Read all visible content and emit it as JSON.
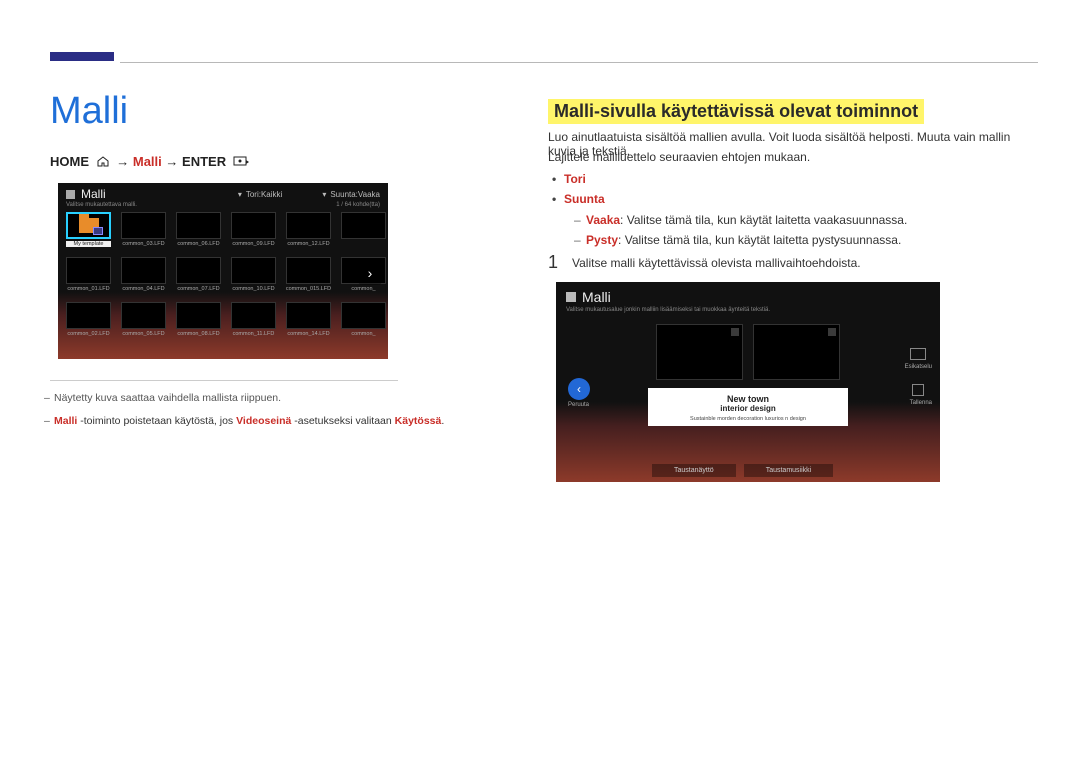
{
  "page": {
    "h1": "Malli",
    "breadcrumb": {
      "home": "HOME",
      "arrow": "→",
      "malli": "Malli",
      "enter": "ENTER"
    },
    "note1": "Näytetty kuva saattaa vaihdella mallista riippuen.",
    "note2_pre": "Malli",
    "note2_mid1": " -toiminto poistetaan käytöstä, jos ",
    "note2_accent2": "Videoseinä",
    "note2_mid2": " -asetukseksi valitaan ",
    "note2_accent3": "Käytössä",
    "note2_end": "."
  },
  "right": {
    "h2": "Malli-sivulla käytettävissä olevat toiminnot",
    "para1": "Luo ainutlaatuista sisältöä mallien avulla. Voit luoda sisältöä helposti. Muuta vain mallin kuvia ja tekstiä.",
    "para2": "Lajittele malliluettelo seuraavien ehtojen mukaan.",
    "b1": "Tori",
    "b2": "Suunta",
    "sb1_accent": "Vaaka",
    "sb1_text": ": Valitse tämä tila, kun käytät laitetta vaakasuunnassa.",
    "sb2_accent": "Pysty",
    "sb2_text": ": Valitse tämä tila, kun käytät laitetta pystysuunnassa.",
    "step_num": "1",
    "step_text": "Valitse malli käytettävissä olevista mallivaihtoehdoista."
  },
  "screen1": {
    "title": "Malli",
    "subtitle": "Valitse mukautettava malli.",
    "drop1": "Tori:Kaikki",
    "drop2": "Suunta:Vaaka",
    "count": "1 / 64 kohde(tta)",
    "items": [
      {
        "cap": "My template",
        "sel": true
      },
      {
        "cap": "common_03.LFD"
      },
      {
        "cap": "common_06.LFD"
      },
      {
        "cap": "common_09.LFD"
      },
      {
        "cap": "common_12.LFD"
      },
      {
        "cap": ""
      },
      {
        "cap": "common_01.LFD"
      },
      {
        "cap": "common_04.LFD"
      },
      {
        "cap": "common_07.LFD"
      },
      {
        "cap": "common_10.LFD"
      },
      {
        "cap": "common_015.LFD"
      },
      {
        "cap": "common_"
      },
      {
        "cap": "common_02.LFD"
      },
      {
        "cap": "common_05.LFD"
      },
      {
        "cap": "common_08.LFD"
      },
      {
        "cap": "common_11.LFD"
      },
      {
        "cap": "common_14.LFD"
      },
      {
        "cap": "common_"
      }
    ]
  },
  "screen2": {
    "title": "Malli",
    "subtitle": "Valitse mukautusalue jonkin malliin lisäämiseksi tai muokkaa äynteitä tekstiä.",
    "card_t1": "New town",
    "card_t2": "interior design",
    "card_t3": "Sustainble morden decoration luxurios n design",
    "tab1": "Taustanäyttö",
    "tab2": "Taustamusiikki",
    "back": "Peruuta",
    "preview": "Esikatselu",
    "save": "Tallenna"
  }
}
